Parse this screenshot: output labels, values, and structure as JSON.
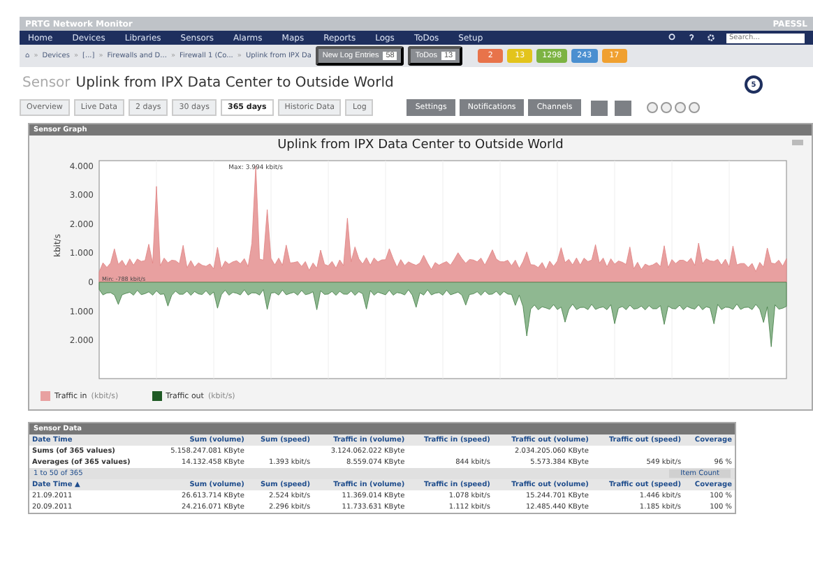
{
  "app": {
    "title": "PRTG Network Monitor",
    "logo": "PAESSL"
  },
  "nav": {
    "items": [
      "Home",
      "Devices",
      "Libraries",
      "Sensors",
      "Alarms",
      "Maps",
      "Reports",
      "Logs",
      "ToDos",
      "Setup"
    ],
    "search": {
      "placeholder": "Search..."
    }
  },
  "breadcrumb": [
    {
      "kind": "link",
      "text": "⌂"
    },
    {
      "kind": "separator",
      "text": "»"
    },
    {
      "kind": "link",
      "text": "Devices"
    },
    {
      "kind": "separator",
      "text": "»"
    },
    {
      "kind": "link",
      "text": "[...]"
    },
    {
      "kind": "separator",
      "text": "»"
    },
    {
      "kind": "link",
      "text": "Firewalls and D..."
    },
    {
      "kind": "separator",
      "text": "»"
    },
    {
      "kind": "link",
      "text": "Firewall 1 (Co..."
    },
    {
      "kind": "separator",
      "text": "»"
    },
    {
      "kind": "link",
      "text": "Uplink from IPX Da"
    }
  ],
  "counters": [
    {
      "label": "New Log Entries",
      "count": "58"
    },
    {
      "label": "ToDos",
      "count": "13"
    }
  ],
  "status_badges": [
    {
      "count": "2",
      "color": "#e8734a"
    },
    {
      "count": "13",
      "color": "#e3c41c"
    },
    {
      "count": "1298",
      "color": "#7cb342"
    },
    {
      "count": "243",
      "color": "#4a8fd0"
    },
    {
      "count": "17",
      "color": "#f0a030"
    }
  ],
  "callout": {
    "label": "5"
  },
  "sensor": {
    "kind_label": "Sensor",
    "name": "Uplink from IPX Data Center to Outside World"
  },
  "tabs": [
    {
      "label": "Overview",
      "selected": false
    },
    {
      "label": "Live Data",
      "selected": false
    },
    {
      "label": "2 days",
      "selected": false
    },
    {
      "label": "30 days",
      "selected": false
    },
    {
      "label": "365 days",
      "selected": true
    },
    {
      "label": "Historic Data",
      "selected": false
    },
    {
      "label": "Log",
      "selected": false
    }
  ],
  "actions": [
    "Settings",
    "Notifications",
    "Channels"
  ],
  "graph": {
    "panel_title": "Sensor Graph",
    "title": "Uplink from IPX Data Center to Outside World",
    "ylabel": "kbit/s",
    "yticks": [
      "4.000",
      "3.000",
      "2.000",
      "1.000",
      "0",
      "1.000",
      "2.000"
    ],
    "max_label": "Max: 3.994 kbit/s",
    "min_label": "Min: -788 kbit/s",
    "legend": [
      {
        "name": "Traffic in",
        "unit": "(kbit/s)",
        "color": "#e8a0a0"
      },
      {
        "name": "Traffic out",
        "unit": "(kbit/s)",
        "color": "#1f5a25"
      }
    ]
  },
  "data": {
    "panel_title": "Sensor Data",
    "columns": [
      "Date Time",
      "Sum (volume)",
      "Sum (speed)",
      "Traffic in (volume)",
      "Traffic in (speed)",
      "Traffic out (volume)",
      "Traffic out (speed)",
      "Coverage"
    ],
    "summary": [
      {
        "date_time": "Sums (of 365 values)",
        "sum_volume": "5.158.247.081 KByte",
        "traffic_in_volume": "3.124.062.022 KByte",
        "traffic_out_volume": "2.034.205.060 KByte"
      },
      {
        "date_time": "Averages (of 365 values)",
        "sum_volume": "14.132.458 KByte",
        "sum_speed": "1.393 kbit/s",
        "traffic_in_volume": "8.559.074 KByte",
        "traffic_in_speed": "844 kbit/s",
        "traffic_out_volume": "5.573.384 KByte",
        "traffic_out_speed": "549 kbit/s",
        "coverage": "96 %"
      }
    ],
    "pager": {
      "range": "1 to 50 of 365",
      "item_count": "Item Count"
    },
    "table_columns": [
      "Date Time ▲",
      "Sum (volume)",
      "Sum (speed)",
      "Traffic in (volume)",
      "Traffic in (speed)",
      "Traffic out (volume)",
      "Traffic out (speed)",
      "Coverage"
    ],
    "rows": [
      [
        "21.09.2011",
        "26.613.714 KByte",
        "2.524 kbit/s",
        "11.369.014 KByte",
        "1.078 kbit/s",
        "15.244.701 KByte",
        "1.446 kbit/s",
        "100 %"
      ],
      [
        "20.09.2011",
        "24.216.071 KByte",
        "2.296 kbit/s",
        "11.733.631 KByte",
        "1.112 kbit/s",
        "12.485.440 KByte",
        "1.185 kbit/s",
        "100 %"
      ]
    ]
  }
}
